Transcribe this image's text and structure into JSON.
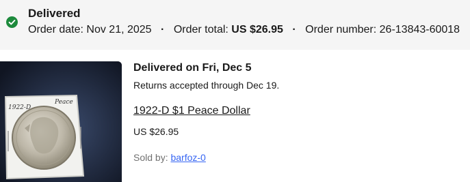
{
  "order": {
    "status": "Delivered",
    "date_label": "Order date:",
    "date": "Nov 21, 2025",
    "total_label": "Order total:",
    "total": "US $26.95",
    "number_label": "Order number:",
    "number": "26-13843-60018",
    "separator": "·"
  },
  "item": {
    "delivery_status": "Delivered on Fri, Dec 5",
    "returns_note": "Returns accepted through Dec 19.",
    "title": "1922-D $1 Peace Dollar",
    "price": "US $26.95",
    "sold_by_label": "Sold by:",
    "seller": "barfoz-0",
    "image_labels": {
      "left": "1922-D",
      "right": "Peace"
    }
  },
  "icons": {
    "status": "check-circle-icon"
  },
  "colors": {
    "success": "#1d8a3c",
    "link": "#3665f3",
    "banner_bg": "#f5f5f5",
    "muted_text": "#707070"
  }
}
